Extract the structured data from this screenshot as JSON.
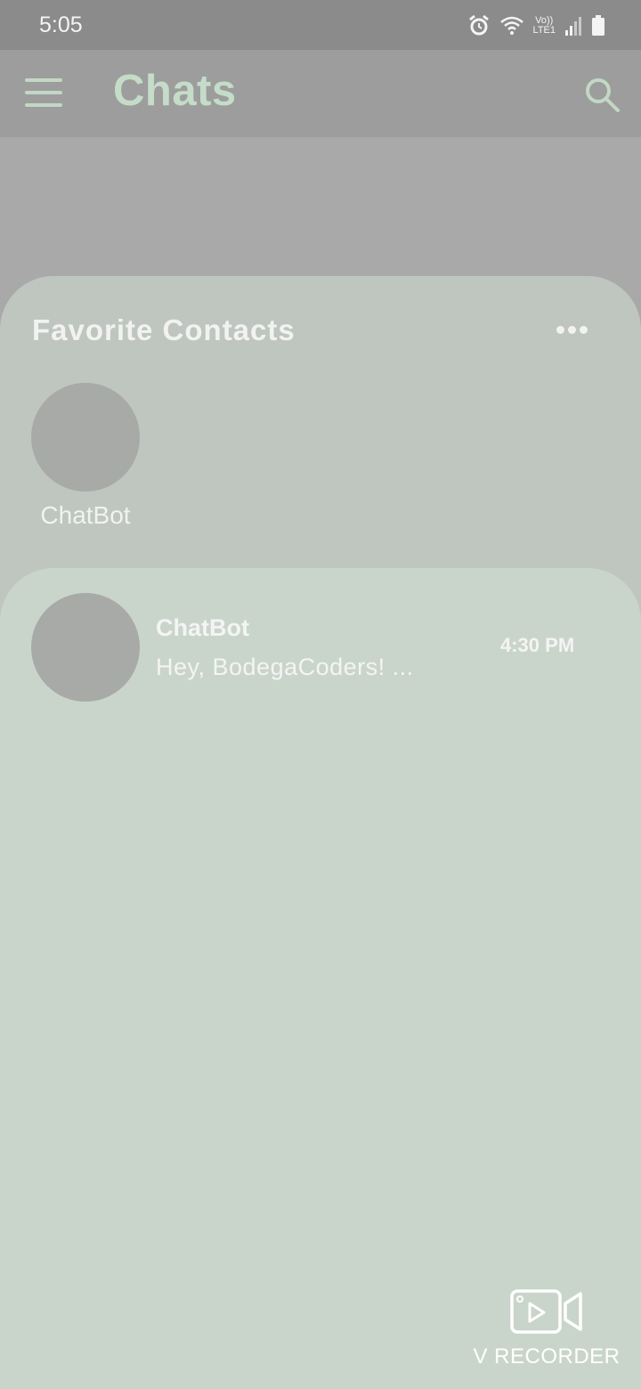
{
  "status_bar": {
    "time": "5:05",
    "icons": [
      "alarm-icon",
      "wifi-icon",
      "volte-icon",
      "signal-icon",
      "battery-icon"
    ],
    "volte_line1": "Vo))",
    "volte_line2": "LTE1"
  },
  "app_bar": {
    "title": "Chats",
    "menu_icon": "hamburger-menu-icon",
    "search_icon": "search-icon"
  },
  "favorites": {
    "title": "Favorite Contacts",
    "more_icon": "more-horizontal-icon",
    "contacts": [
      {
        "name": "ChatBot"
      }
    ]
  },
  "chats": [
    {
      "name": "ChatBot",
      "preview": "Hey, BodegaCoders! ...",
      "time": "4:30 PM"
    }
  ],
  "watermark": {
    "label": "V RECORDER",
    "icon": "video-recorder-icon"
  },
  "colors": {
    "status_bar": "#8b8b8b",
    "app_bar": "#9d9d9d",
    "title_accent": "#c5dcc8",
    "favorites_panel": "#bec6bf",
    "chats_panel": "#c9d5ca",
    "avatar": "#a7aaa7"
  }
}
